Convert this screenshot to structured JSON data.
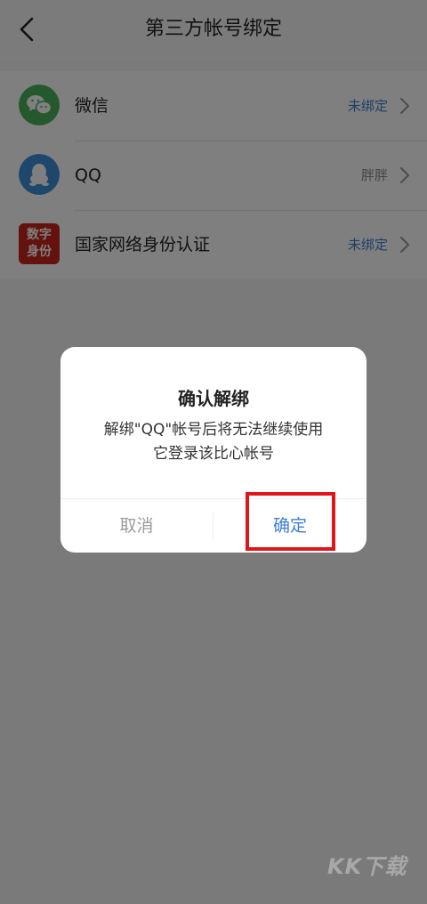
{
  "header": {
    "title": "第三方帐号绑定",
    "back_icon": "chevron-left-icon"
  },
  "accounts": [
    {
      "label": "微信",
      "status": "未绑定",
      "icon": "wechat-icon"
    },
    {
      "label": "QQ",
      "status": "胖胖",
      "icon": "qq-penguin-icon"
    },
    {
      "label": "国家网络身份认证",
      "status": "未绑定",
      "icon": "digital-id-icon",
      "icon_text": [
        "数字",
        "身份"
      ]
    }
  ],
  "dialog": {
    "title": "确认解绑",
    "message_line1": "解绑\"QQ\"帐号后将无法继续使用",
    "message_line2": "它登录该比心帐号",
    "cancel_label": "取消",
    "confirm_label": "确定"
  },
  "watermark": "KK下载",
  "colors": {
    "accent_blue": "#3e7fd1",
    "status_gray": "#888888",
    "wechat_green": "#4db15a",
    "qq_blue": "#3f8fd9",
    "id_red": "#c8241d",
    "highlight_red": "#e0151b"
  }
}
